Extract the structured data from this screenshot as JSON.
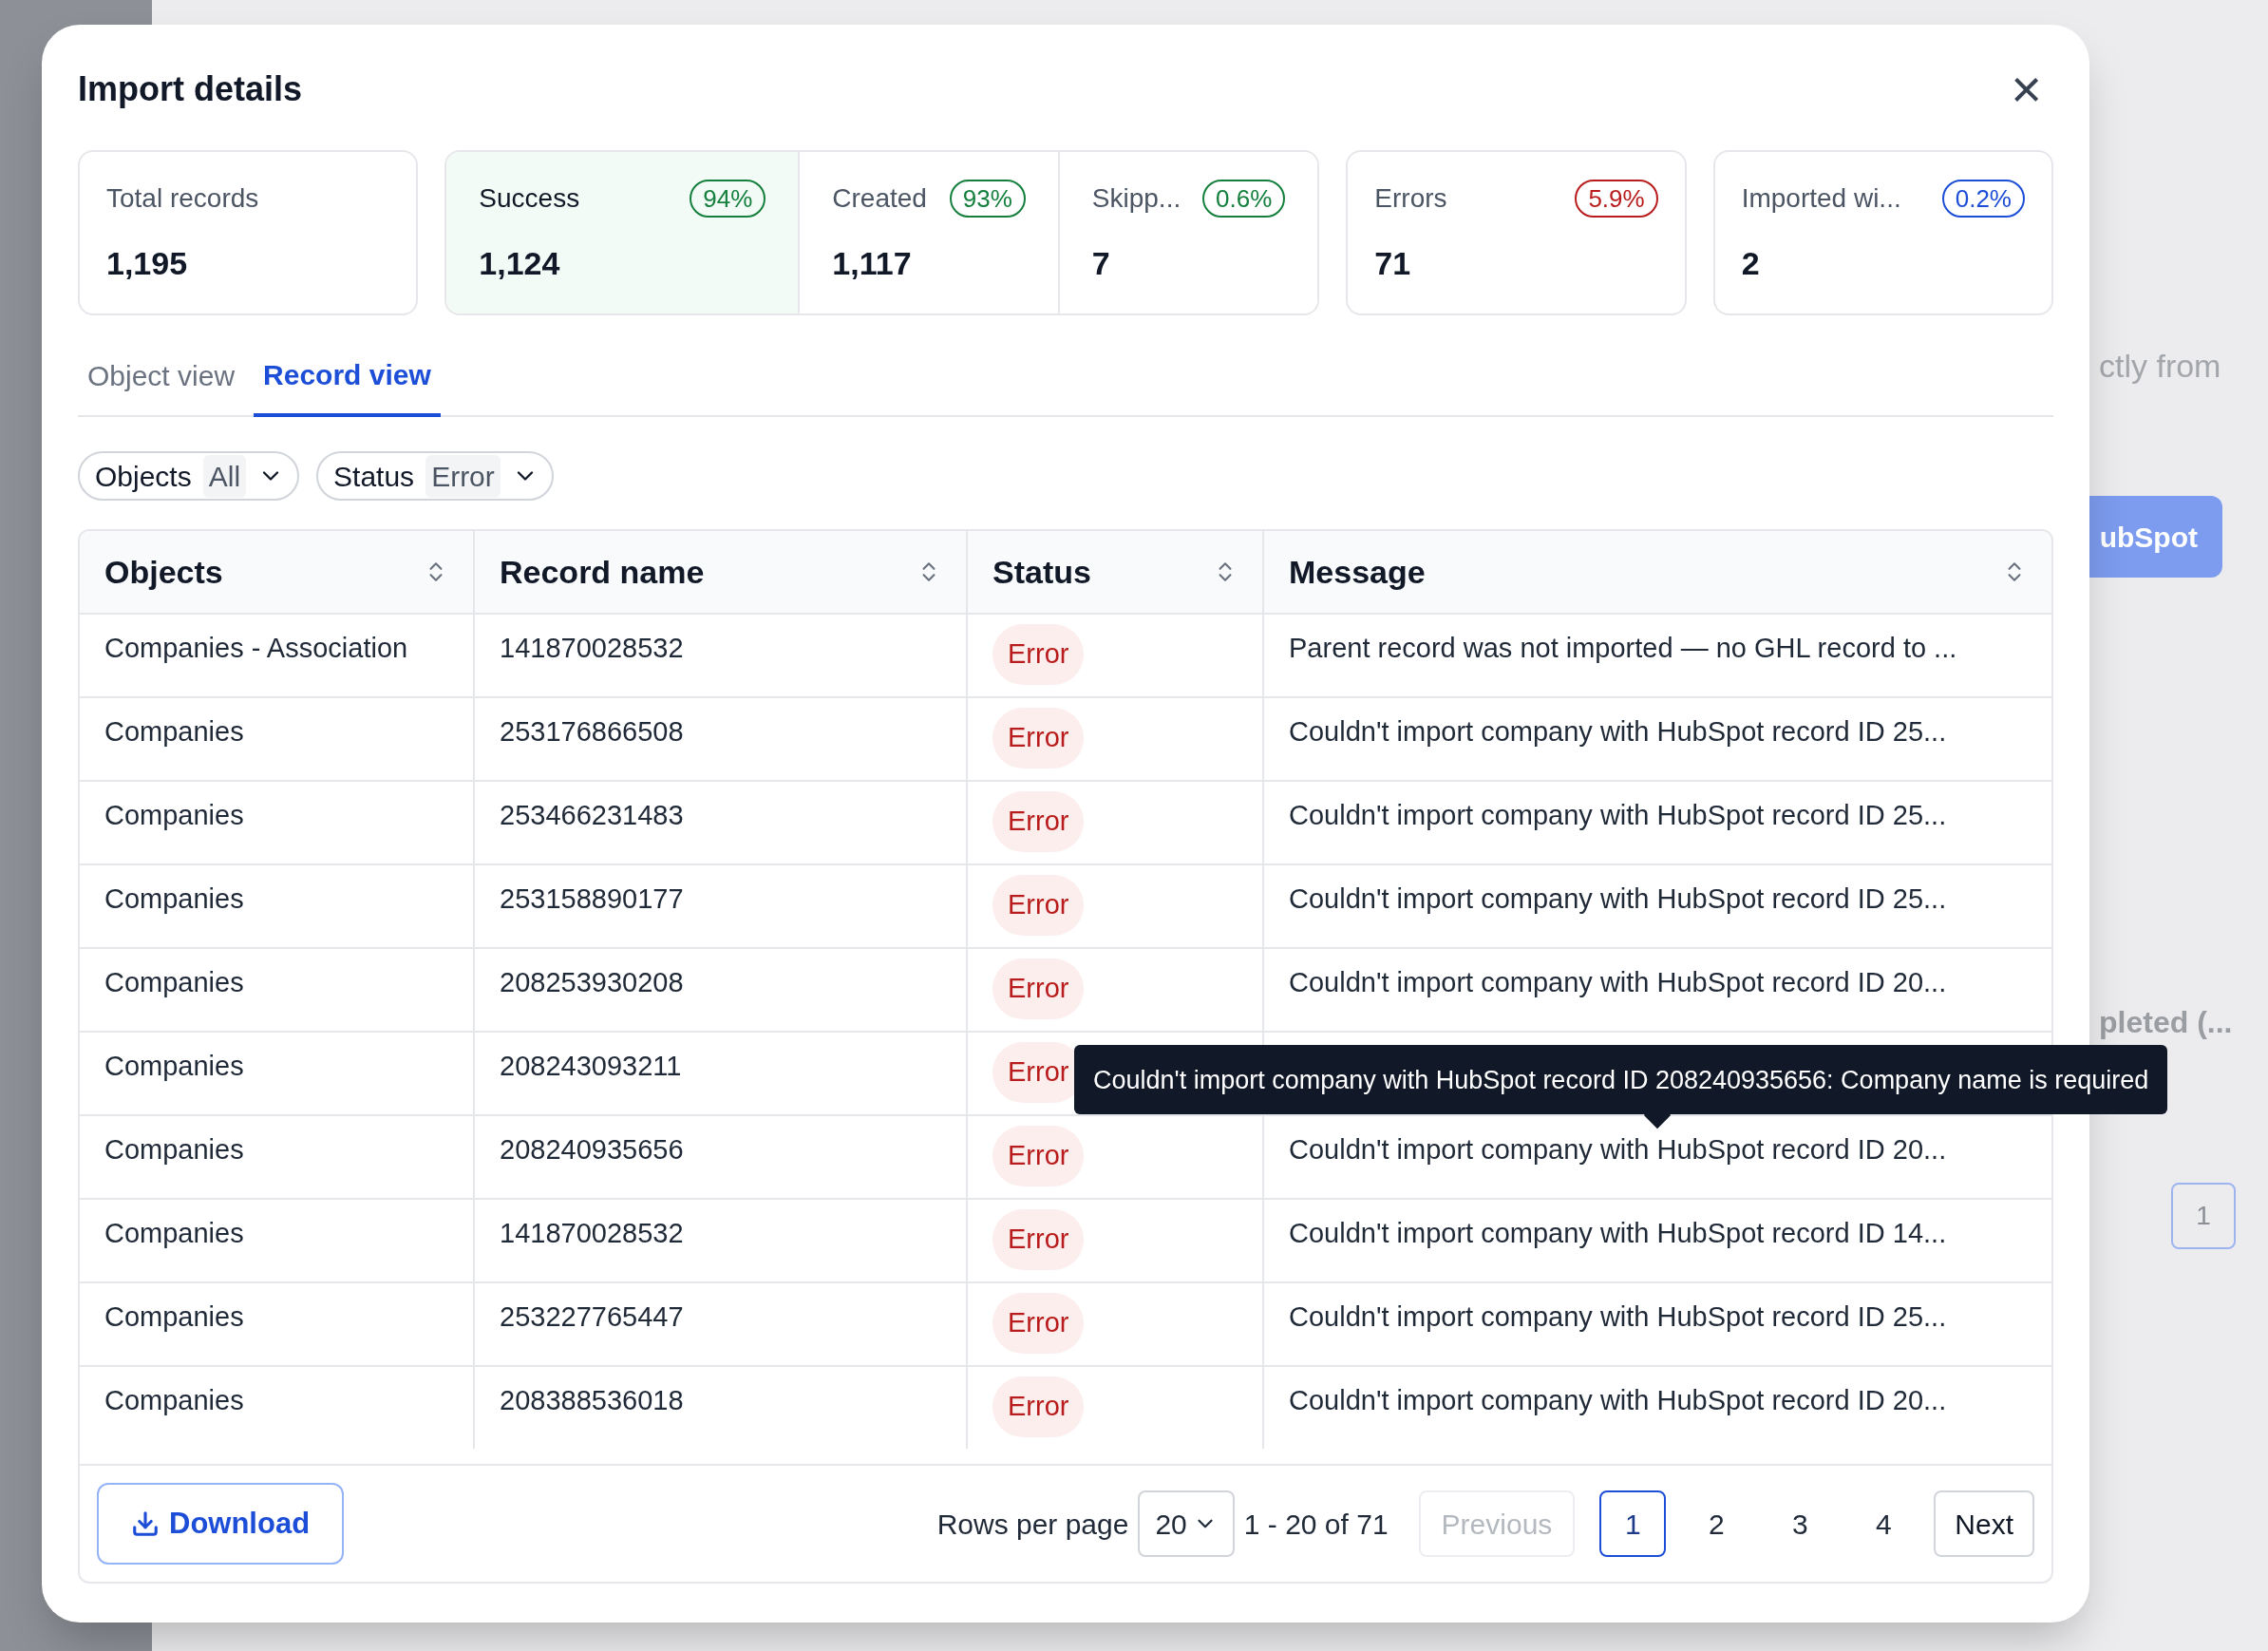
{
  "background": {
    "texts": [
      "ctly from",
      "pleted (..."
    ],
    "button": "ubSpot",
    "page": "1"
  },
  "dialog": {
    "title": "Import details",
    "close": "×"
  },
  "cards": [
    {
      "kind": "single",
      "label": "Total records",
      "value": "1,195"
    },
    {
      "kind": "group",
      "items": [
        {
          "label": "Success",
          "value": "1,124",
          "badge": "94%",
          "color": "#15803d",
          "highlighted": true
        },
        {
          "label": "Created",
          "value": "1,117",
          "badge": "93%",
          "color": "#15803d",
          "highlighted": false
        },
        {
          "label": "Skipp...",
          "value": "7",
          "badge": "0.6%",
          "color": "#15803d",
          "highlighted": false
        }
      ]
    },
    {
      "kind": "single",
      "label": "Errors",
      "value": "71",
      "badge": "5.9%",
      "color": "#b91c1c"
    },
    {
      "kind": "single",
      "label": "Imported wi...",
      "value": "2",
      "badge": "0.2%",
      "color": "#1d4ed8"
    }
  ],
  "tabs": [
    {
      "label": "Object view",
      "selected": false
    },
    {
      "label": "Record view",
      "selected": true
    }
  ],
  "filters": [
    {
      "label": "Objects",
      "value": "All"
    },
    {
      "label": "Status",
      "value": "Error"
    }
  ],
  "table": {
    "columns": [
      "Objects",
      "Record name",
      "Status",
      "Message"
    ],
    "rows": [
      {
        "object": "Companies - Association",
        "record": "141870028532",
        "status": "Error",
        "message": "Parent record was not imported — no GHL record to ..."
      },
      {
        "object": "Companies",
        "record": "253176866508",
        "status": "Error",
        "message": "Couldn't import company with HubSpot record ID 25..."
      },
      {
        "object": "Companies",
        "record": "253466231483",
        "status": "Error",
        "message": "Couldn't import company with HubSpot record ID 25..."
      },
      {
        "object": "Companies",
        "record": "253158890177",
        "status": "Error",
        "message": "Couldn't import company with HubSpot record ID 25..."
      },
      {
        "object": "Companies",
        "record": "208253930208",
        "status": "Error",
        "message": "Couldn't import company with HubSpot record ID 20..."
      },
      {
        "object": "Companies",
        "record": "208243093211",
        "status": "Error",
        "message": ""
      },
      {
        "object": "Companies",
        "record": "208240935656",
        "status": "Error",
        "message": "Couldn't import company with HubSpot record ID 20..."
      },
      {
        "object": "Companies",
        "record": "141870028532",
        "status": "Error",
        "message": "Couldn't import company with HubSpot record ID 14..."
      },
      {
        "object": "Companies",
        "record": "253227765447",
        "status": "Error",
        "message": "Couldn't import company with HubSpot record ID 25..."
      },
      {
        "object": "Companies",
        "record": "208388536018",
        "status": "Error",
        "message": "Couldn't import company with HubSpot record ID 20..."
      }
    ]
  },
  "tooltip": "Couldn't import company with HubSpot record ID 208240935656: Company name is required",
  "footer": {
    "download": "Download",
    "rows_per_page_label": "Rows per page",
    "rows_per_page": "20",
    "range": "1 - 20 of 71",
    "previous": {
      "label": "Previous",
      "disabled": true
    },
    "pages": [
      {
        "label": "1",
        "selected": true
      },
      {
        "label": "2",
        "selected": false
      },
      {
        "label": "3",
        "selected": false
      },
      {
        "label": "4",
        "selected": false
      }
    ],
    "next": {
      "label": "Next",
      "disabled": false
    }
  }
}
